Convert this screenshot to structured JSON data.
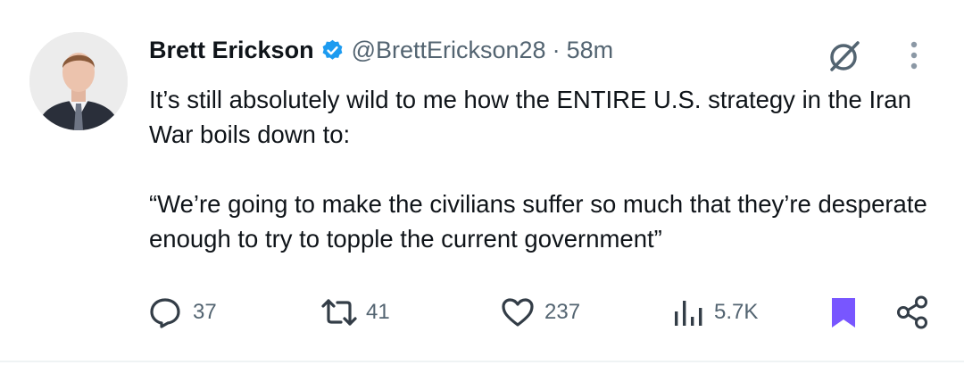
{
  "author": {
    "name": "Brett Erickson",
    "handle": "@BrettErickson28",
    "separator": "·",
    "time": "58m",
    "verified_color": "#1d9bf0"
  },
  "icons": {
    "avatar": "profile-photo",
    "verified": "verified-badge-icon",
    "grok": "grok-icon",
    "more": "more-vertical-icon"
  },
  "tweet": {
    "paragraphs": [
      "It’s still absolutely wild to me how the ENTIRE U.S. strategy in the Iran War boils down to:",
      "“We’re going to make the civilians suffer so much that they’re desperate enough to try to topple the current government”"
    ]
  },
  "actions": {
    "reply": {
      "icon": "reply-icon",
      "count": "37"
    },
    "retweet": {
      "icon": "retweet-icon",
      "count": "41"
    },
    "like": {
      "icon": "heart-icon",
      "count": "237"
    },
    "views": {
      "icon": "views-icon",
      "count": "5.7K"
    },
    "bookmark": {
      "icon": "bookmark-icon",
      "color": "#7856ff"
    },
    "share": {
      "icon": "share-icon"
    }
  }
}
